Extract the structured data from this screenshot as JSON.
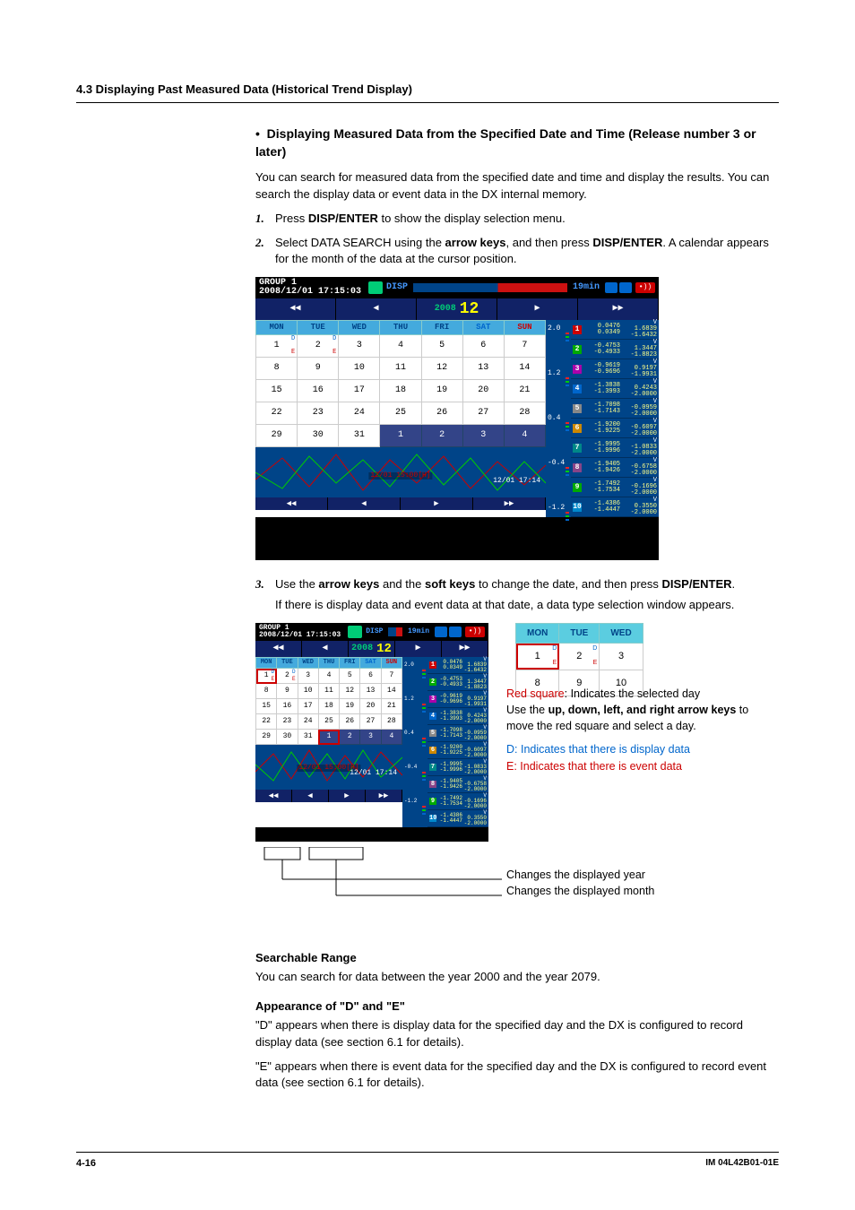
{
  "header": "4.3  Displaying Past Measured Data (Historical Trend Display)",
  "bullet_heading": "•  Displaying Measured Data from the Specified Date and Time (Release number 3 or later)",
  "intro": "You can search for measured data from the specified date and time and display the results. You can search the display data or event data in the DX internal memory.",
  "step1_pre": "Press ",
  "step1_b": "DISP/ENTER",
  "step1_post": " to show the display selection menu.",
  "step2_pre": "Select DATA SEARCH using the ",
  "step2_b1": "arrow keys",
  "step2_mid": ", and then press ",
  "step2_b2": "DISP/ENTER",
  "step2_post": ". A calendar appears for the month of the data at the cursor position.",
  "step3_pre": "Use the ",
  "step3_b1": "arrow keys",
  "step3_mid1": " and the ",
  "step3_b2": "soft keys",
  "step3_mid2": " to change the date, and then press ",
  "step3_b3": "DISP/ENTER",
  "step3_post": ".",
  "step3_note": "If there is display data and event data at that date, a data type selection window appears.",
  "device": {
    "group_label": "GROUP 1",
    "group_date": "2008/12/01 17:15:03",
    "disp_label": "DISP",
    "time_label": "19min",
    "year": "2008",
    "month": "12",
    "dow": [
      "MON",
      "TUE",
      "WED",
      "THU",
      "FRI",
      "SAT",
      "SUN"
    ],
    "days": [
      [
        {
          "n": "1",
          "d": true,
          "e": true
        },
        {
          "n": "2",
          "d": true,
          "e": true
        },
        {
          "n": "3"
        },
        {
          "n": "4"
        },
        {
          "n": "5"
        },
        {
          "n": "6"
        },
        {
          "n": "7"
        }
      ],
      [
        {
          "n": "8"
        },
        {
          "n": "9"
        },
        {
          "n": "10"
        },
        {
          "n": "11"
        },
        {
          "n": "12"
        },
        {
          "n": "13"
        },
        {
          "n": "14"
        }
      ],
      [
        {
          "n": "15"
        },
        {
          "n": "16"
        },
        {
          "n": "17"
        },
        {
          "n": "18"
        },
        {
          "n": "19"
        },
        {
          "n": "20"
        },
        {
          "n": "21"
        }
      ],
      [
        {
          "n": "22"
        },
        {
          "n": "23"
        },
        {
          "n": "24"
        },
        {
          "n": "25"
        },
        {
          "n": "26"
        },
        {
          "n": "27"
        },
        {
          "n": "28"
        }
      ],
      [
        {
          "n": "29"
        },
        {
          "n": "30"
        },
        {
          "n": "31"
        },
        {
          "n": "1",
          "nm": true
        },
        {
          "n": "2",
          "nm": true
        },
        {
          "n": "3",
          "nm": true
        },
        {
          "n": "4",
          "nm": true
        }
      ]
    ],
    "trend_label": "12/01 15:00[H]",
    "trend_ts": "12/01 17:14",
    "axis": [
      "2.0",
      "1.2",
      "0.4",
      "-0.4",
      "-1.2"
    ],
    "channels": [
      {
        "n": "1",
        "bg": "#c00",
        "v1": "0.0476",
        "v2": "0.0349",
        "v3": "1.6839",
        "v4": "-1.6432"
      },
      {
        "n": "2",
        "bg": "#0a0",
        "v1": "-0.4753",
        "v2": "-0.4933",
        "v3": "1.3447",
        "v4": "-1.8823"
      },
      {
        "n": "3",
        "bg": "#a0a",
        "v1": "-0.9619",
        "v2": "-0.9696",
        "v3": "0.9197",
        "v4": "-1.9931"
      },
      {
        "n": "4",
        "bg": "#06c",
        "v1": "-1.3838",
        "v2": "-1.3993",
        "v3": "0.4243",
        "v4": "-2.0000"
      },
      {
        "n": "5",
        "bg": "#888",
        "v1": "-1.7098",
        "v2": "-1.7143",
        "v3": "-0.0959",
        "v4": "-2.0000"
      },
      {
        "n": "6",
        "bg": "#c80",
        "v1": "-1.9200",
        "v2": "-1.9225",
        "v3": "-0.6097",
        "v4": "-2.0000"
      },
      {
        "n": "7",
        "bg": "#088",
        "v1": "-1.9995",
        "v2": "-1.9996",
        "v3": "-1.0833",
        "v4": "-2.0000"
      },
      {
        "n": "8",
        "bg": "#848",
        "v1": "-1.9405",
        "v2": "-1.9426",
        "v3": "-0.6758",
        "v4": "-2.0000"
      },
      {
        "n": "9",
        "bg": "#0a0",
        "v1": "-1.7492",
        "v2": "-1.7534",
        "v3": "-0.1696",
        "v4": "-2.0000"
      },
      {
        "n": "10",
        "bg": "#08c",
        "v1": "-1.4386",
        "v2": "-1.4447",
        "v3": "0.3550",
        "v4": "-2.0000"
      }
    ]
  },
  "mini_cal": {
    "dow": [
      "MON",
      "TUE",
      "WED"
    ],
    "rows": [
      [
        {
          "n": "1",
          "d": true,
          "e": true,
          "sel": true
        },
        {
          "n": "2",
          "d": true,
          "e": true
        },
        {
          "n": "3"
        }
      ],
      [
        {
          "n": "8"
        },
        {
          "n": "9"
        },
        {
          "n": "10"
        }
      ]
    ]
  },
  "legend": {
    "red_pre": "Red square",
    "red_rest": ": Indicates the selected day",
    "move_pre": "Use the ",
    "move_b": "up, down, left, and right arrow keys",
    "move_post": " to move the red square and select a day.",
    "d_pre": "D",
    "d_rest": ": Indicates that there is display data",
    "e_pre": "E",
    "e_rest": ": Indicates that there is event data",
    "callout_year": "Changes the displayed year",
    "callout_month": "Changes the displayed month"
  },
  "searchable_head": "Searchable Range",
  "searchable_body": "You can search for data between the year 2000 and the year 2079.",
  "de_head": "Appearance of \"D\" and \"E\"",
  "de_body1": "\"D\" appears when there is display data for the specified day and the DX is configured to record display data (see section 6.1 for details).",
  "de_body2": "\"E\" appears when there is event data for the specified day and the DX is configured to record event data (see section 6.1 for details).",
  "footer": {
    "page": "4-16",
    "doc": "IM 04L42B01-01E"
  }
}
